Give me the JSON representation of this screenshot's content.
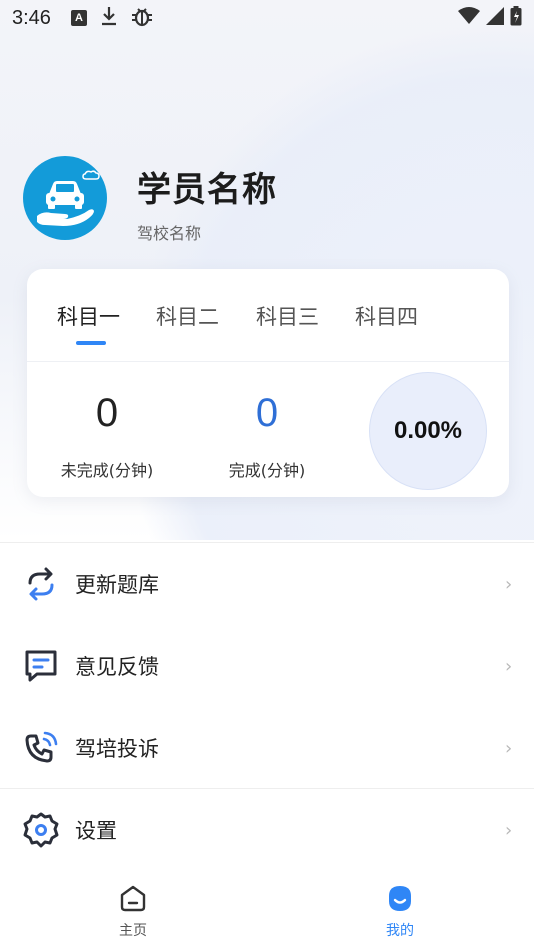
{
  "status_bar": {
    "time": "3:46",
    "icons": [
      "a-badge-icon",
      "download-icon",
      "bug-icon",
      "wifi-icon",
      "signal-icon",
      "battery-icon"
    ]
  },
  "profile": {
    "name": "学员名称",
    "school": "驾校名称",
    "avatar_color": "#139bd9"
  },
  "subjects": {
    "tabs": [
      {
        "label": "科目一",
        "active": true
      },
      {
        "label": "科目二",
        "active": false
      },
      {
        "label": "科目三",
        "active": false
      },
      {
        "label": "科目四",
        "active": false
      }
    ],
    "incomplete": {
      "value": "0",
      "label": "未完成(分钟)"
    },
    "complete": {
      "value": "0",
      "label": "完成(分钟)"
    },
    "progress": "0.00%",
    "accent_color": "#2f86f6"
  },
  "menu": [
    {
      "label": "更新题库",
      "icon": "refresh-icon"
    },
    {
      "label": "意见反馈",
      "icon": "feedback-icon"
    },
    {
      "label": "驾培投诉",
      "icon": "phone-icon"
    },
    {
      "label": "设置",
      "icon": "gear-icon"
    }
  ],
  "chevron": "›",
  "bottom_nav": [
    {
      "label": "主页",
      "icon": "home-icon",
      "active": false
    },
    {
      "label": "我的",
      "icon": "profile-icon",
      "active": true
    }
  ]
}
